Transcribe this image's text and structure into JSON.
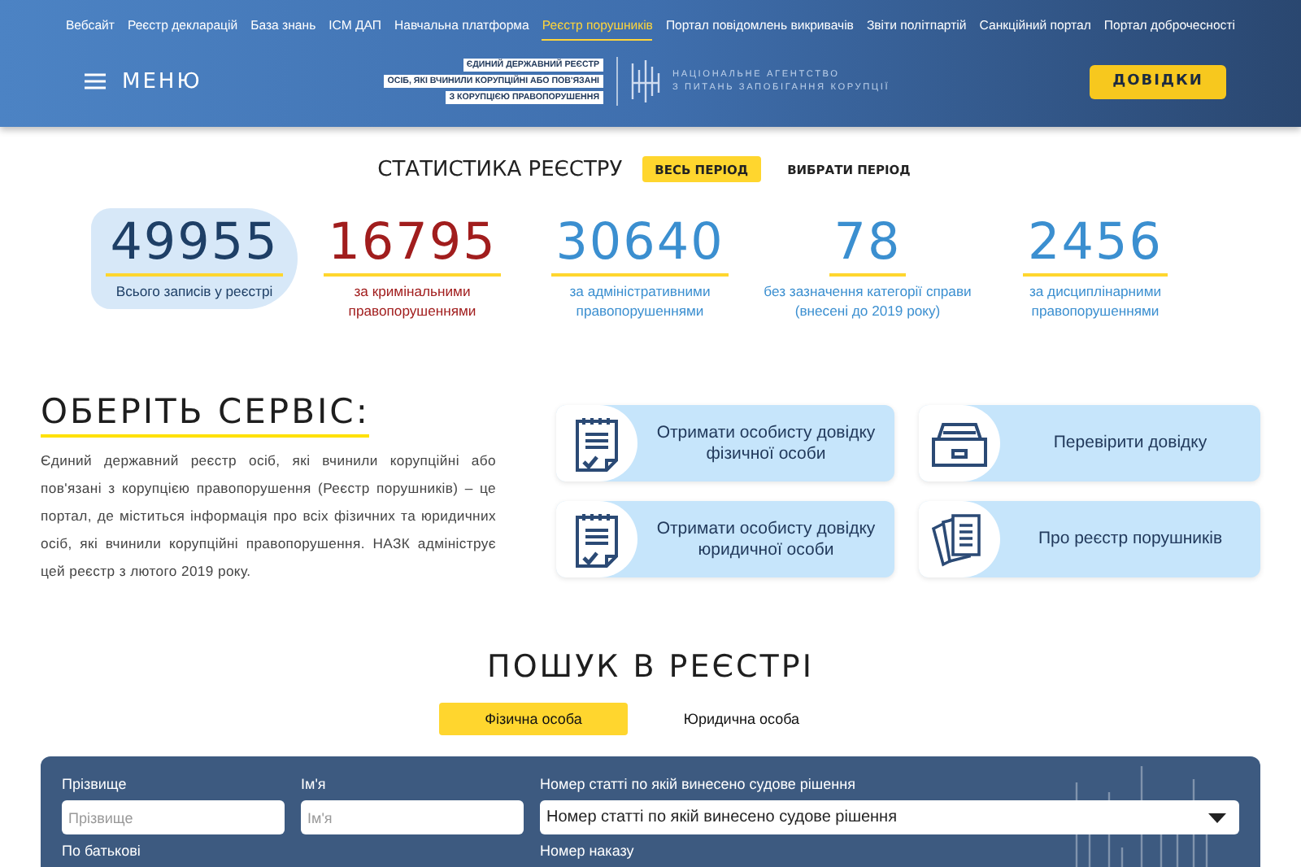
{
  "nav": {
    "links": [
      {
        "label": "Вебсайт",
        "selected": false
      },
      {
        "label": "Реєстр декларацій",
        "selected": false
      },
      {
        "label": "База знань",
        "selected": false
      },
      {
        "label": "ІСМ ДАП",
        "selected": false
      },
      {
        "label": "Навчальна платформа",
        "selected": false
      },
      {
        "label": "Реєстр порушників",
        "selected": true
      },
      {
        "label": "Портал повідомлень викривачів",
        "selected": false
      },
      {
        "label": "Звіти політпартій",
        "selected": false
      },
      {
        "label": "Санкційний портал",
        "selected": false
      },
      {
        "label": "Портал доброчесності",
        "selected": false
      }
    ],
    "menu_label": "МЕНЮ",
    "registry_logo_lines": [
      "ЄДИНИЙ ДЕРЖАВНИЙ РЕЄСТР",
      "ОСІБ, ЯКІ ВЧИНИЛИ КОРУПЦІЙНІ АБО ПОВ'ЯЗАНІ",
      "З КОРУПЦІЄЮ ПРАВОПОРУШЕННЯ"
    ],
    "agency_lines": [
      "НАЦІОНАЛЬНЕ АГЕНТСТВО",
      "З ПИТАНЬ ЗАПОБІГАННЯ КОРУПЦІЇ"
    ],
    "button": "ДОВІДКИ"
  },
  "stats": {
    "title": "СТАТИСТИКА РЕЄСТРУ",
    "periods": [
      {
        "label": "ВЕСЬ ПЕРІОД",
        "selected": true
      },
      {
        "label": "ВИБРАТИ ПЕРІОД",
        "selected": false
      }
    ],
    "items": [
      {
        "value": "49955",
        "label": "Всього записів у реєстрі",
        "color": "#1e3f66",
        "selected": true
      },
      {
        "value": "16795",
        "label": "за кримінальними правопорушеннями",
        "color": "#a11d1d",
        "selected": false
      },
      {
        "value": "30640",
        "label": "за адміністративними правопорушеннями",
        "color": "#3b8fd0",
        "selected": false
      },
      {
        "value": "78",
        "label": "без зазначення категорії справи (внесені до 2019 року)",
        "color": "#3b8fd0",
        "selected": false
      },
      {
        "value": "2456",
        "label": "за дисциплінарними правопорушеннями",
        "color": "#3b8fd0",
        "selected": false
      }
    ]
  },
  "services": {
    "title": "ОБЕРІТЬ СЕРВІС:",
    "description": "Єдиний державний реєстр осіб, які вчинили корупційні або пов'язані з корупцією правопорушення (Реєстр порушників) – це портал, де міститься інформація про всіх фізичних та юридичних осіб, які вчинили корупційні правопорушення. НАЗК адмініструє цей реєстр з лютого 2019 року.",
    "items": [
      {
        "label": "Отримати особисту довідку фізичної особи",
        "kind": "document"
      },
      {
        "label": "Перевірити довідку",
        "kind": "drawer"
      },
      {
        "label": "Отримати особисту довідку юридичної особи",
        "kind": "document"
      },
      {
        "label": "Про реєстр порушників",
        "kind": "papers"
      }
    ]
  },
  "search": {
    "title": "ПОШУК В РЕЄСТРІ",
    "tabs": [
      {
        "label": "Фізична особа",
        "selected": true
      },
      {
        "label": "Юридична особа",
        "selected": false
      }
    ],
    "fields": [
      {
        "label": "Прізвище",
        "placeholder": "Прізвище",
        "kind": "text"
      },
      {
        "label": "Ім'я",
        "placeholder": "Ім'я",
        "kind": "text"
      },
      {
        "label": "Номер статті по якій винесено судове рішення",
        "value": "Номер статті по якій винесено судове рішення",
        "kind": "select"
      },
      {
        "label": "По батькові",
        "kind": "label"
      },
      {
        "label": "Номер наказу",
        "kind": "label"
      }
    ]
  }
}
